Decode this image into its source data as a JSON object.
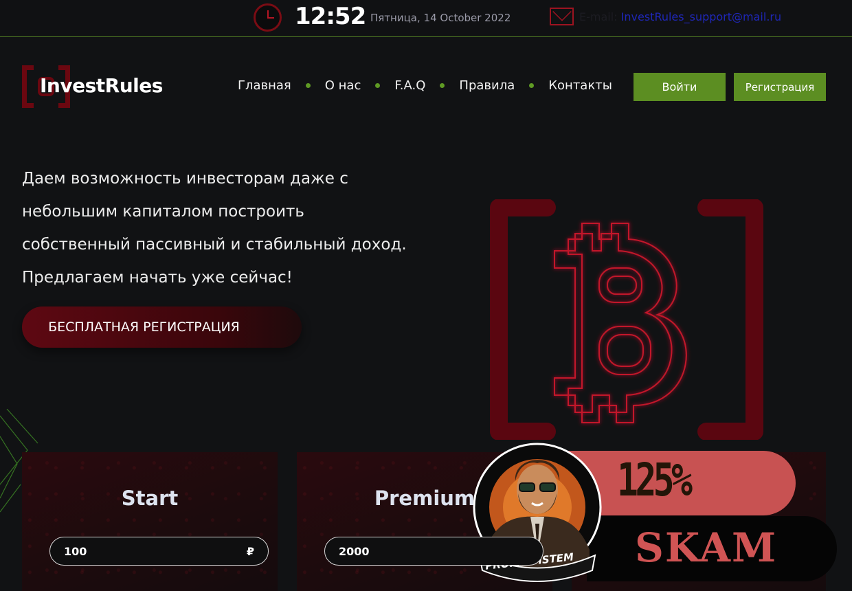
{
  "topbar": {
    "time": "12:52",
    "date": "Пятница, 14 October 2022",
    "email_label": "E-mail:",
    "email": "InvestRules_support@mail.ru"
  },
  "header": {
    "logo_text": "InvestRules",
    "nav": [
      "Главная",
      "О нас",
      "F.A.Q",
      "Правила",
      "Контакты"
    ],
    "login_label": "Войти",
    "register_label": "Регистрация"
  },
  "hero": {
    "lines": [
      "Даем возможность инвесторам даже с",
      "небольшим капиталом построить",
      "собственный пассивный и стабильный доход.",
      "Предлагаем начать уже сейчас!"
    ],
    "cta_label": "БЕСПЛАТНАЯ РЕГИСТРАЦИЯ"
  },
  "plans": [
    {
      "title": "Start",
      "amount": "100",
      "currency": "₽"
    },
    {
      "title": "Premium",
      "amount": "2000",
      "currency": ""
    }
  ],
  "overlay": {
    "percent": "125%",
    "label": "SKAM",
    "avatar_name": "PROFIT SISTEM"
  },
  "colors": {
    "accent_green": "#5c8e22",
    "brand_red": "#6b0710",
    "badge_red": "#c85252",
    "background": "#111214"
  }
}
